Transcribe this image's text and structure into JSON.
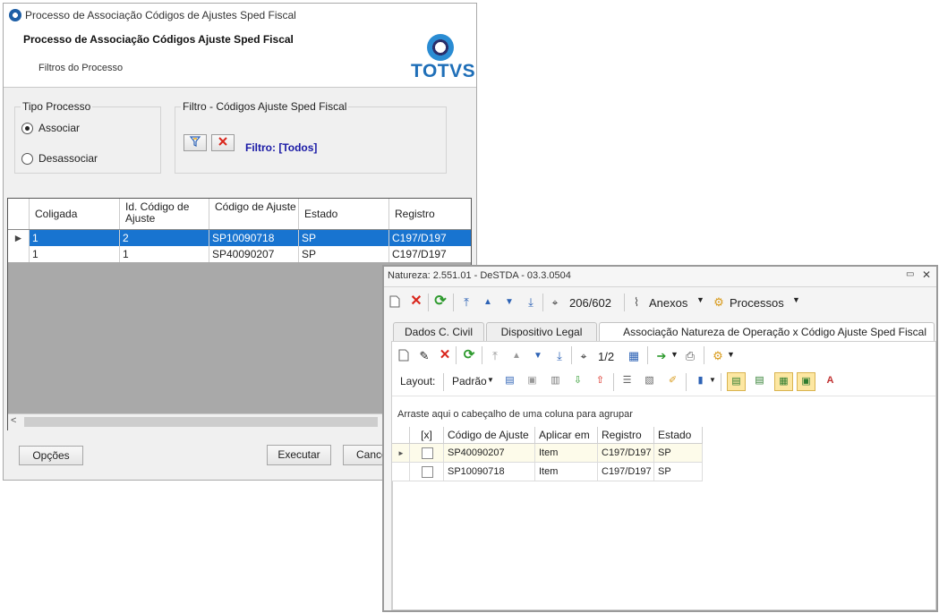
{
  "win1": {
    "title": "Processo de Associação Códigos de Ajustes Sped Fiscal",
    "header_title": "Processo de Associação Códigos Ajuste Sped Fiscal",
    "header_subtitle": "Filtros do Processo",
    "logo_text": "TOTVS",
    "tipo_processo": {
      "legend": "Tipo Processo",
      "options": [
        {
          "label": "Associar",
          "selected": true
        },
        {
          "label": "Desassociar",
          "selected": false
        }
      ]
    },
    "filtro": {
      "legend": "Filtro  - Códigos Ajuste Sped Fiscal",
      "status": "Filtro: [Todos]"
    },
    "grid": {
      "columns": [
        "Coligada",
        "Id. Código de Ajuste",
        "Código de Ajuste",
        "Estado",
        "Registro"
      ],
      "rows": [
        [
          "1",
          "2",
          "SP10090718",
          "SP",
          "C197/D197"
        ],
        [
          "1",
          "1",
          "SP40090207",
          "SP",
          "C197/D197"
        ]
      ]
    },
    "buttons": {
      "opcoes": "Opções",
      "executar": "Executar",
      "cancelar": "Cance"
    }
  },
  "win2": {
    "title": "Natureza: 2.551.01 - DeSTDA - 03.3.0504",
    "toolbar": {
      "record_count": "206/602",
      "anexos": "Anexos",
      "processos": "Processos"
    },
    "tabs": [
      "Dados C. Civil",
      "Dispositivo Legal",
      "Associação Natureza de Operação x Código Ajuste Sped Fiscal"
    ],
    "inner_toolbar": {
      "page": "1/2"
    },
    "layout_label": "Layout:",
    "padrao_label": "Padrão",
    "group_hint": "Arraste aqui o cabeçalho de uma coluna para agrupar",
    "grid": {
      "columns": [
        "[x]",
        "Código de Ajuste",
        "Aplicar em",
        "Registro",
        "Estado"
      ],
      "rows": [
        {
          "checked": false,
          "codigo": "SP40090207",
          "aplicar": "Item",
          "registro": "C197/D197",
          "estado": "SP"
        },
        {
          "checked": false,
          "codigo": "SP10090718",
          "aplicar": "Item",
          "registro": "C197/D197",
          "estado": "SP"
        }
      ]
    }
  },
  "colors": {
    "selection": "#1874d0",
    "filter_text": "#1a1aa6",
    "delete_red": "#d9261c",
    "refresh_green": "#2e9a2e",
    "nav_blue": "#2d62b5"
  }
}
